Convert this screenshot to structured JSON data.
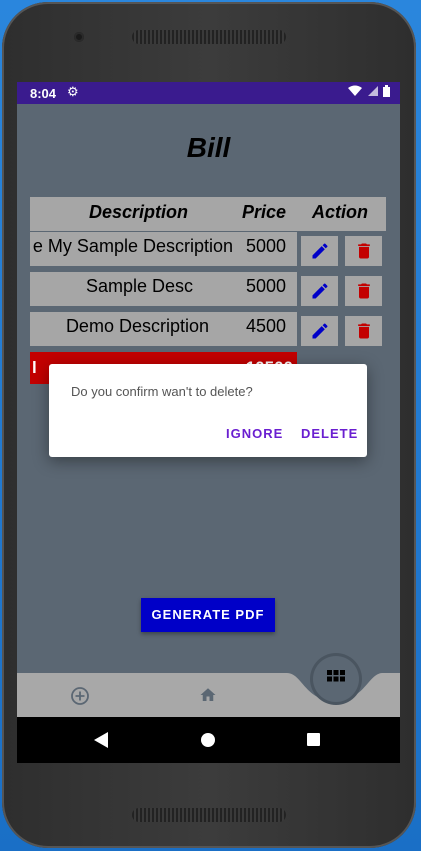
{
  "status": {
    "time": "8:04"
  },
  "page": {
    "title": "Bill"
  },
  "table": {
    "headers": {
      "description": "Description",
      "price": "Price",
      "action": "Action"
    },
    "rows": [
      {
        "description": "e My Sample Description",
        "price": "5000"
      },
      {
        "description": "Sample Desc",
        "price": "5000"
      },
      {
        "description": "Demo Description",
        "price": "4500"
      }
    ],
    "total": {
      "label": "l",
      "value": "10500"
    }
  },
  "dialog": {
    "message": "Do you confirm wan't to delete?",
    "ignore": "IGNORE",
    "delete": "DELETE"
  },
  "actions": {
    "generate_pdf": "GENERATE PDF"
  },
  "colors": {
    "accent": "#0000c8",
    "danger": "#c30000",
    "statusbar": "#3a1b8e",
    "dialog_button": "#6a1fd0"
  },
  "icons": [
    "settings-icon",
    "wifi-icon",
    "signal-icon",
    "battery-icon",
    "edit-icon",
    "delete-icon",
    "add-icon",
    "home-icon",
    "grid-icon",
    "back-icon",
    "home-circle-icon",
    "recents-icon"
  ]
}
